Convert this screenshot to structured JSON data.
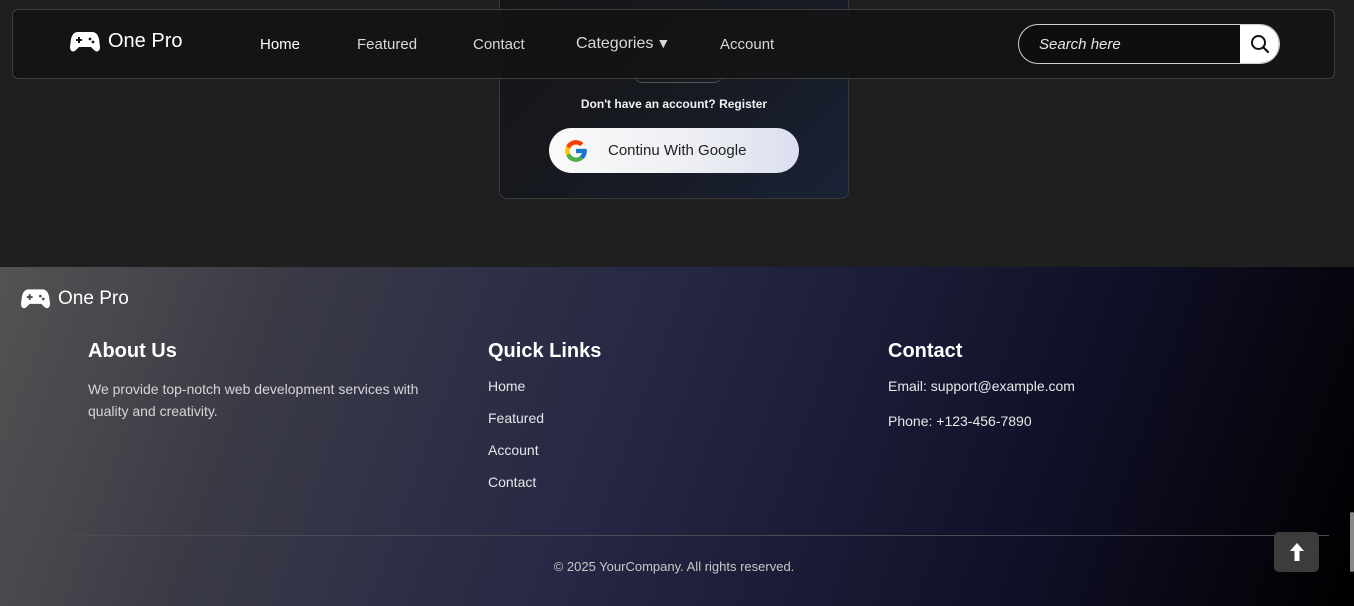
{
  "navbar": {
    "brand": "One Pro",
    "links": [
      {
        "label": "Home"
      },
      {
        "label": "Featured"
      },
      {
        "label": "Contact"
      },
      {
        "label": "Categories"
      },
      {
        "label": "Account"
      }
    ],
    "search_placeholder": "Search here"
  },
  "login": {
    "register_prompt": "Don't have an account? Register",
    "google_label": "Continu With Google"
  },
  "footer": {
    "brand": "One Pro",
    "about": {
      "title": "About Us",
      "text": "We provide top-notch web development services with quality and creativity."
    },
    "quick_links": {
      "title": "Quick Links",
      "items": [
        "Home",
        "Featured",
        "Account",
        "Contact"
      ]
    },
    "contact": {
      "title": "Contact",
      "email": "Email: support@example.com",
      "phone": "Phone: +123-456-7890"
    },
    "copyright": "© 2025 YourCompany. All rights reserved."
  },
  "icons": {
    "logo": "gamepad-icon",
    "search": "search-icon",
    "google": "google-icon",
    "back_to_top": "arrow-up-icon",
    "categories_caret": "caret-down-icon"
  }
}
